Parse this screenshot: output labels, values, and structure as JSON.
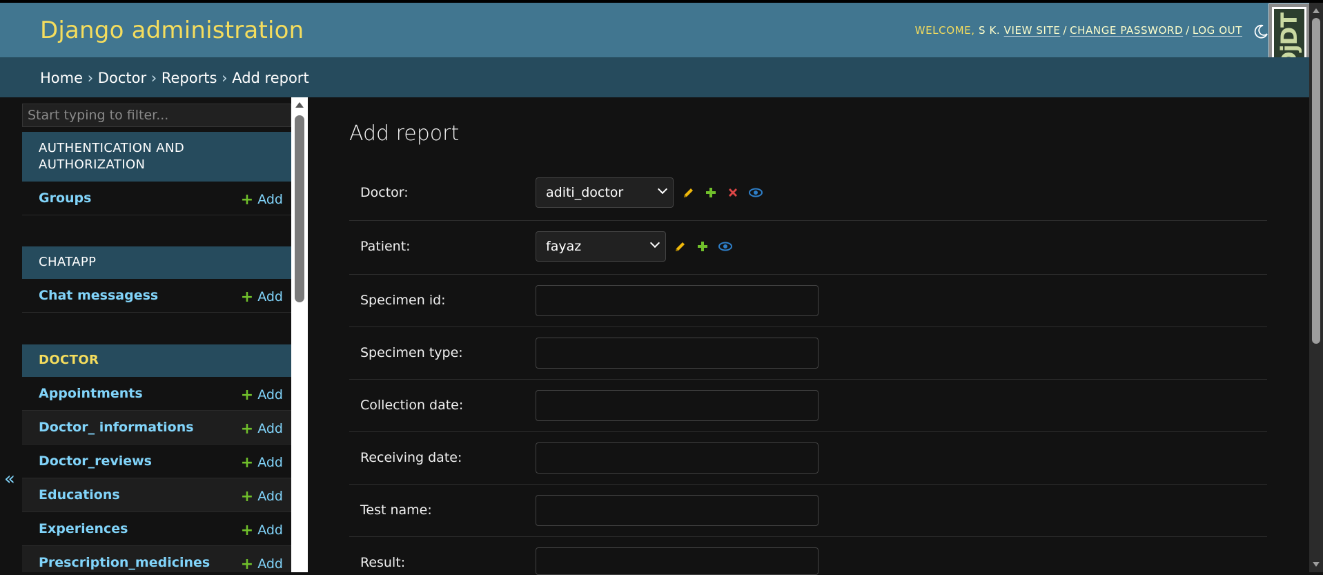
{
  "header": {
    "brand": "Django administration",
    "welcome": "WELCOME,",
    "username": "S K.",
    "view_site": "VIEW SITE",
    "change_password": "CHANGE PASSWORD",
    "log_out": "LOG OUT",
    "separator": "/",
    "toolbar_badge": "DjDT"
  },
  "breadcrumbs": {
    "home": "Home",
    "app": "Doctor",
    "model": "Reports",
    "current": "Add report",
    "sep": "›"
  },
  "sidebar": {
    "toggle": "«",
    "filter_placeholder": "Start typing to filter...",
    "add_label": "Add",
    "modules": [
      {
        "caption": "AUTHENTICATION AND AUTHORIZATION",
        "models": [
          "Groups"
        ]
      },
      {
        "caption": "CHATAPP",
        "models": [
          "Chat messagess"
        ]
      },
      {
        "caption": "DOCTOR",
        "current": true,
        "models": [
          "Appointments",
          "Doctor_ informations",
          "Doctor_reviews",
          "Educations",
          "Experiences",
          "Prescription_medicines"
        ]
      }
    ]
  },
  "main": {
    "title": "Add report",
    "fields": {
      "doctor": {
        "label": "Doctor:",
        "value": "aditi_doctor"
      },
      "patient": {
        "label": "Patient:",
        "value": "fayaz"
      },
      "specimen_id": {
        "label": "Specimen id:",
        "value": ""
      },
      "specimen_type": {
        "label": "Specimen type:",
        "value": ""
      },
      "collection_date": {
        "label": "Collection date:",
        "value": ""
      },
      "receiving_date": {
        "label": "Receiving date:",
        "value": ""
      },
      "test_name": {
        "label": "Test name:",
        "value": ""
      },
      "result": {
        "label": "Result:",
        "value": ""
      }
    }
  },
  "colors": {
    "header_bg": "#417690",
    "breadcrumb_bg": "#264b5d",
    "brand_text": "#f5dd5d",
    "link": "#81d4fa",
    "add_plus": "#70bf2b",
    "change_pencil": "#efb80b",
    "delete_x": "#dd4646",
    "view_eye": "#2e7fc9"
  },
  "icons": [
    "moon-icon",
    "pencil-icon",
    "plus-icon",
    "delete-icon",
    "eye-icon",
    "chevron-down-icon"
  ]
}
